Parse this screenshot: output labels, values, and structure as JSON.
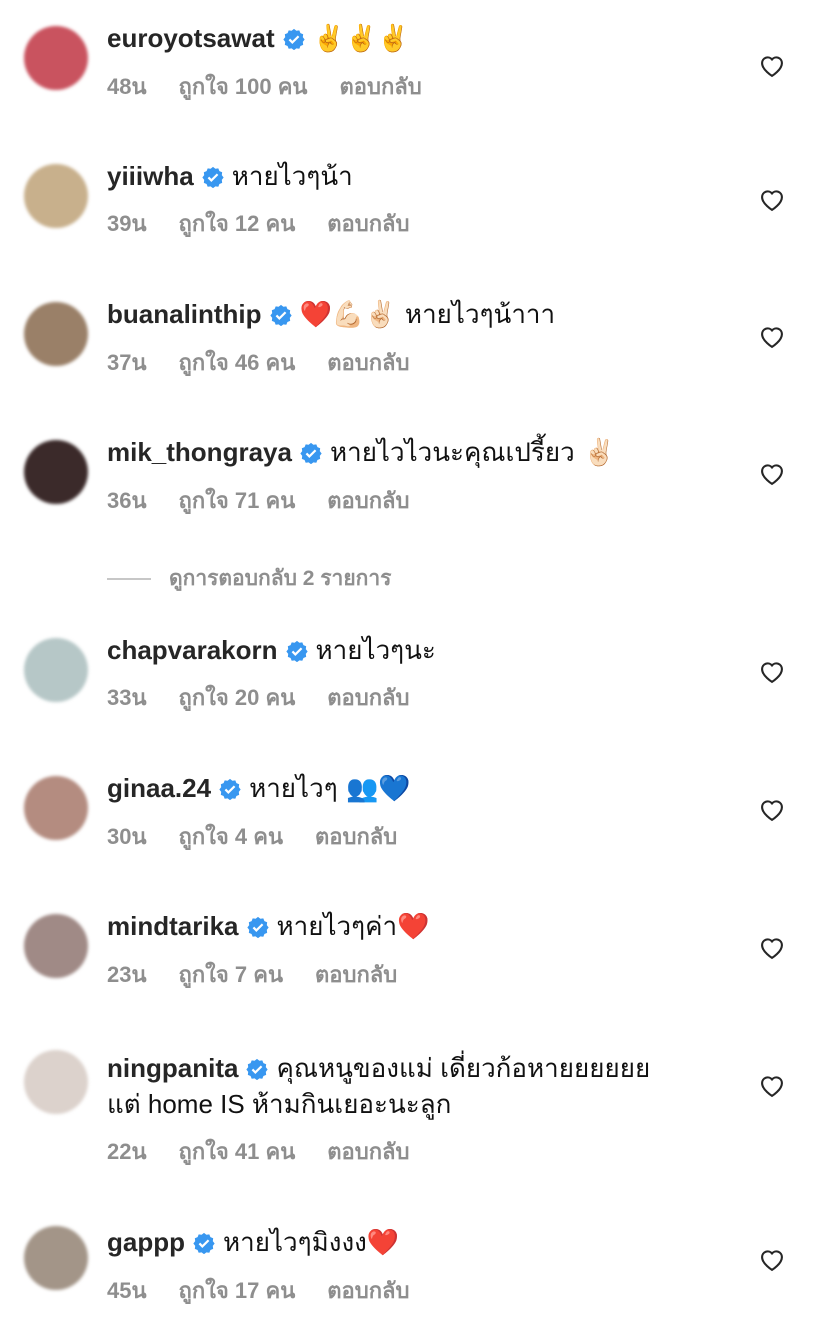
{
  "comments": [
    {
      "username": "euroyotsawat",
      "text": "✌️✌️✌️",
      "time": "48น",
      "likes": "ถูกใจ 100 คน",
      "reply": "ตอบกลับ",
      "avatar_color": "#c9535f"
    },
    {
      "username": "yiiiwha",
      "text": "หายไวๆน้า",
      "time": "39น",
      "likes": "ถูกใจ 12 คน",
      "reply": "ตอบกลับ",
      "avatar_color": "#c8b08c"
    },
    {
      "username": "buanalinthip",
      "text": "❤️💪🏻✌🏻 หายไวๆน้าาา",
      "time": "37น",
      "likes": "ถูกใจ 46 คน",
      "reply": "ตอบกลับ",
      "avatar_color": "#9a8068"
    },
    {
      "username": "mik_thongraya",
      "text": "หายไวไวนะคุณเปรี้ยว ✌🏻",
      "time": "36น",
      "likes": "ถูกใจ 71 คน",
      "reply": "ตอบกลับ",
      "avatar_color": "#3b2a2a"
    },
    {
      "username": "chapvarakorn",
      "text": "หายไวๆนะ",
      "time": "33น",
      "likes": "ถูกใจ 20 คน",
      "reply": "ตอบกลับ",
      "avatar_color": "#b6c7c7"
    },
    {
      "username": "ginaa.24",
      "text": "หายไวๆ 👥💙",
      "time": "30น",
      "likes": "ถูกใจ 4 คน",
      "reply": "ตอบกลับ",
      "avatar_color": "#b48c80"
    },
    {
      "username": "mindtarika",
      "text": "หายไวๆค่า❤️",
      "time": "23น",
      "likes": "ถูกใจ 7 คน",
      "reply": "ตอบกลับ",
      "avatar_color": "#a08a86"
    },
    {
      "username": "ningpanita",
      "text": "คุณหนูของแม่ เดี่ยวก้อหายยยยยย",
      "text2": "แต่ home IS ห้ามกินเยอะนะลูก",
      "time": "22น",
      "likes": "ถูกใจ 41 คน",
      "reply": "ตอบกลับ",
      "avatar_color": "#dcd2cc"
    },
    {
      "username": "gappp",
      "text": "หายไวๆมิงงง❤️",
      "time": "45น",
      "likes": "ถูกใจ 17 คน",
      "reply": "ตอบกลับ",
      "avatar_color": "#a39588"
    }
  ],
  "view_replies": "ดูการตอบกลับ 2 รายการ",
  "colors": {
    "verified": "#3897f0",
    "meta": "#8e8e8e"
  }
}
